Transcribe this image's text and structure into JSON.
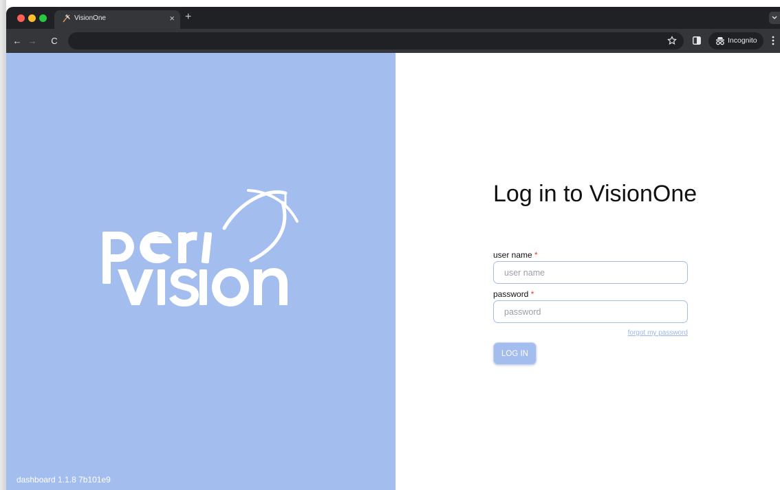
{
  "browser": {
    "tab_title": "VisionOne",
    "tab_close": "×",
    "new_tab": "+",
    "back": "←",
    "forward": "→",
    "reload": "C",
    "address": "",
    "incognito_label": "Incognito",
    "icons": [
      "close-icon",
      "new-tab-icon",
      "back-icon",
      "forward-icon",
      "reload-icon",
      "star-icon",
      "side-panel-icon",
      "incognito-icon",
      "menu-icon",
      "tab-search-icon"
    ]
  },
  "brand": {
    "logo_text": "peri vision",
    "version": "dashboard  1.1.8  7b101e9",
    "background_color": "#a3bdee"
  },
  "login": {
    "title": "Log in to VisionOne",
    "username_label": "user name",
    "username_placeholder": "user name",
    "username_value": "",
    "password_label": "password",
    "password_placeholder": "password",
    "password_value": "",
    "required_mark": "*",
    "forgot_label": "forgot my password",
    "submit_label": "LOG IN",
    "accent_color": "#a3bdee",
    "required_color": "#e53935"
  }
}
